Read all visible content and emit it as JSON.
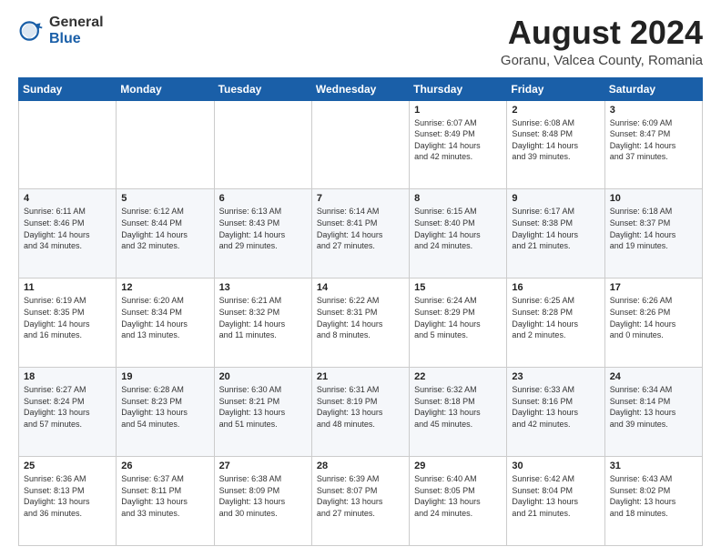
{
  "header": {
    "logo": {
      "general": "General",
      "blue": "Blue"
    },
    "title": "August 2024",
    "location": "Goranu, Valcea County, Romania"
  },
  "weekdays": [
    "Sunday",
    "Monday",
    "Tuesday",
    "Wednesday",
    "Thursday",
    "Friday",
    "Saturday"
  ],
  "weeks": [
    [
      {
        "day": "",
        "info": ""
      },
      {
        "day": "",
        "info": ""
      },
      {
        "day": "",
        "info": ""
      },
      {
        "day": "",
        "info": ""
      },
      {
        "day": "1",
        "info": "Sunrise: 6:07 AM\nSunset: 8:49 PM\nDaylight: 14 hours\nand 42 minutes."
      },
      {
        "day": "2",
        "info": "Sunrise: 6:08 AM\nSunset: 8:48 PM\nDaylight: 14 hours\nand 39 minutes."
      },
      {
        "day": "3",
        "info": "Sunrise: 6:09 AM\nSunset: 8:47 PM\nDaylight: 14 hours\nand 37 minutes."
      }
    ],
    [
      {
        "day": "4",
        "info": "Sunrise: 6:11 AM\nSunset: 8:46 PM\nDaylight: 14 hours\nand 34 minutes."
      },
      {
        "day": "5",
        "info": "Sunrise: 6:12 AM\nSunset: 8:44 PM\nDaylight: 14 hours\nand 32 minutes."
      },
      {
        "day": "6",
        "info": "Sunrise: 6:13 AM\nSunset: 8:43 PM\nDaylight: 14 hours\nand 29 minutes."
      },
      {
        "day": "7",
        "info": "Sunrise: 6:14 AM\nSunset: 8:41 PM\nDaylight: 14 hours\nand 27 minutes."
      },
      {
        "day": "8",
        "info": "Sunrise: 6:15 AM\nSunset: 8:40 PM\nDaylight: 14 hours\nand 24 minutes."
      },
      {
        "day": "9",
        "info": "Sunrise: 6:17 AM\nSunset: 8:38 PM\nDaylight: 14 hours\nand 21 minutes."
      },
      {
        "day": "10",
        "info": "Sunrise: 6:18 AM\nSunset: 8:37 PM\nDaylight: 14 hours\nand 19 minutes."
      }
    ],
    [
      {
        "day": "11",
        "info": "Sunrise: 6:19 AM\nSunset: 8:35 PM\nDaylight: 14 hours\nand 16 minutes."
      },
      {
        "day": "12",
        "info": "Sunrise: 6:20 AM\nSunset: 8:34 PM\nDaylight: 14 hours\nand 13 minutes."
      },
      {
        "day": "13",
        "info": "Sunrise: 6:21 AM\nSunset: 8:32 PM\nDaylight: 14 hours\nand 11 minutes."
      },
      {
        "day": "14",
        "info": "Sunrise: 6:22 AM\nSunset: 8:31 PM\nDaylight: 14 hours\nand 8 minutes."
      },
      {
        "day": "15",
        "info": "Sunrise: 6:24 AM\nSunset: 8:29 PM\nDaylight: 14 hours\nand 5 minutes."
      },
      {
        "day": "16",
        "info": "Sunrise: 6:25 AM\nSunset: 8:28 PM\nDaylight: 14 hours\nand 2 minutes."
      },
      {
        "day": "17",
        "info": "Sunrise: 6:26 AM\nSunset: 8:26 PM\nDaylight: 14 hours\nand 0 minutes."
      }
    ],
    [
      {
        "day": "18",
        "info": "Sunrise: 6:27 AM\nSunset: 8:24 PM\nDaylight: 13 hours\nand 57 minutes."
      },
      {
        "day": "19",
        "info": "Sunrise: 6:28 AM\nSunset: 8:23 PM\nDaylight: 13 hours\nand 54 minutes."
      },
      {
        "day": "20",
        "info": "Sunrise: 6:30 AM\nSunset: 8:21 PM\nDaylight: 13 hours\nand 51 minutes."
      },
      {
        "day": "21",
        "info": "Sunrise: 6:31 AM\nSunset: 8:19 PM\nDaylight: 13 hours\nand 48 minutes."
      },
      {
        "day": "22",
        "info": "Sunrise: 6:32 AM\nSunset: 8:18 PM\nDaylight: 13 hours\nand 45 minutes."
      },
      {
        "day": "23",
        "info": "Sunrise: 6:33 AM\nSunset: 8:16 PM\nDaylight: 13 hours\nand 42 minutes."
      },
      {
        "day": "24",
        "info": "Sunrise: 6:34 AM\nSunset: 8:14 PM\nDaylight: 13 hours\nand 39 minutes."
      }
    ],
    [
      {
        "day": "25",
        "info": "Sunrise: 6:36 AM\nSunset: 8:13 PM\nDaylight: 13 hours\nand 36 minutes."
      },
      {
        "day": "26",
        "info": "Sunrise: 6:37 AM\nSunset: 8:11 PM\nDaylight: 13 hours\nand 33 minutes."
      },
      {
        "day": "27",
        "info": "Sunrise: 6:38 AM\nSunset: 8:09 PM\nDaylight: 13 hours\nand 30 minutes."
      },
      {
        "day": "28",
        "info": "Sunrise: 6:39 AM\nSunset: 8:07 PM\nDaylight: 13 hours\nand 27 minutes."
      },
      {
        "day": "29",
        "info": "Sunrise: 6:40 AM\nSunset: 8:05 PM\nDaylight: 13 hours\nand 24 minutes."
      },
      {
        "day": "30",
        "info": "Sunrise: 6:42 AM\nSunset: 8:04 PM\nDaylight: 13 hours\nand 21 minutes."
      },
      {
        "day": "31",
        "info": "Sunrise: 6:43 AM\nSunset: 8:02 PM\nDaylight: 13 hours\nand 18 minutes."
      }
    ]
  ]
}
